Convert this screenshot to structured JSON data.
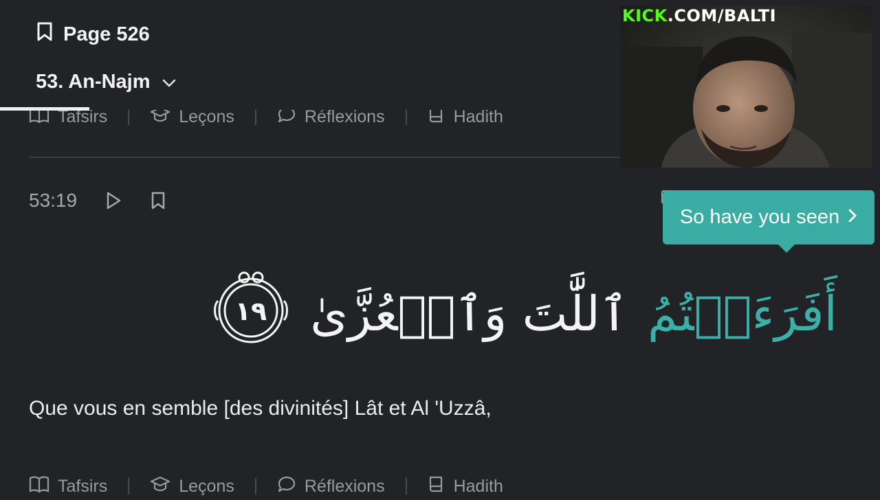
{
  "header": {
    "page_label": "Page 526",
    "surah_label": "53. An-Najm"
  },
  "actions": {
    "tafsirs": "Tafsirs",
    "lecons": "Leçons",
    "reflexions": "Réflexions",
    "hadith": "Hadith"
  },
  "verse": {
    "key": "53:19",
    "arabic_highlight": "أَفَرَءَيۡتُمُ",
    "arabic_rest": "ٱللَّٰتَ وَٱلۡعُزَّىٰ",
    "number": "١٩",
    "translation": "Que vous en semble [des divinités] Lât et Al 'Uzzâ,"
  },
  "tooltip": {
    "text": "So have you seen",
    "chevron": "›"
  },
  "overlay": {
    "brand": "KICK",
    "channel": ".COM/BALTI"
  },
  "colors": {
    "background": "#222326",
    "accent": "#3aaca4",
    "kick_green": "#53fc18"
  },
  "icons": [
    "bookmark-icon",
    "chevron-down-icon",
    "book-icon",
    "graduation-cap-icon",
    "chat-bubble-icon",
    "hadith-book-icon",
    "play-icon",
    "chevron-right-icon"
  ]
}
